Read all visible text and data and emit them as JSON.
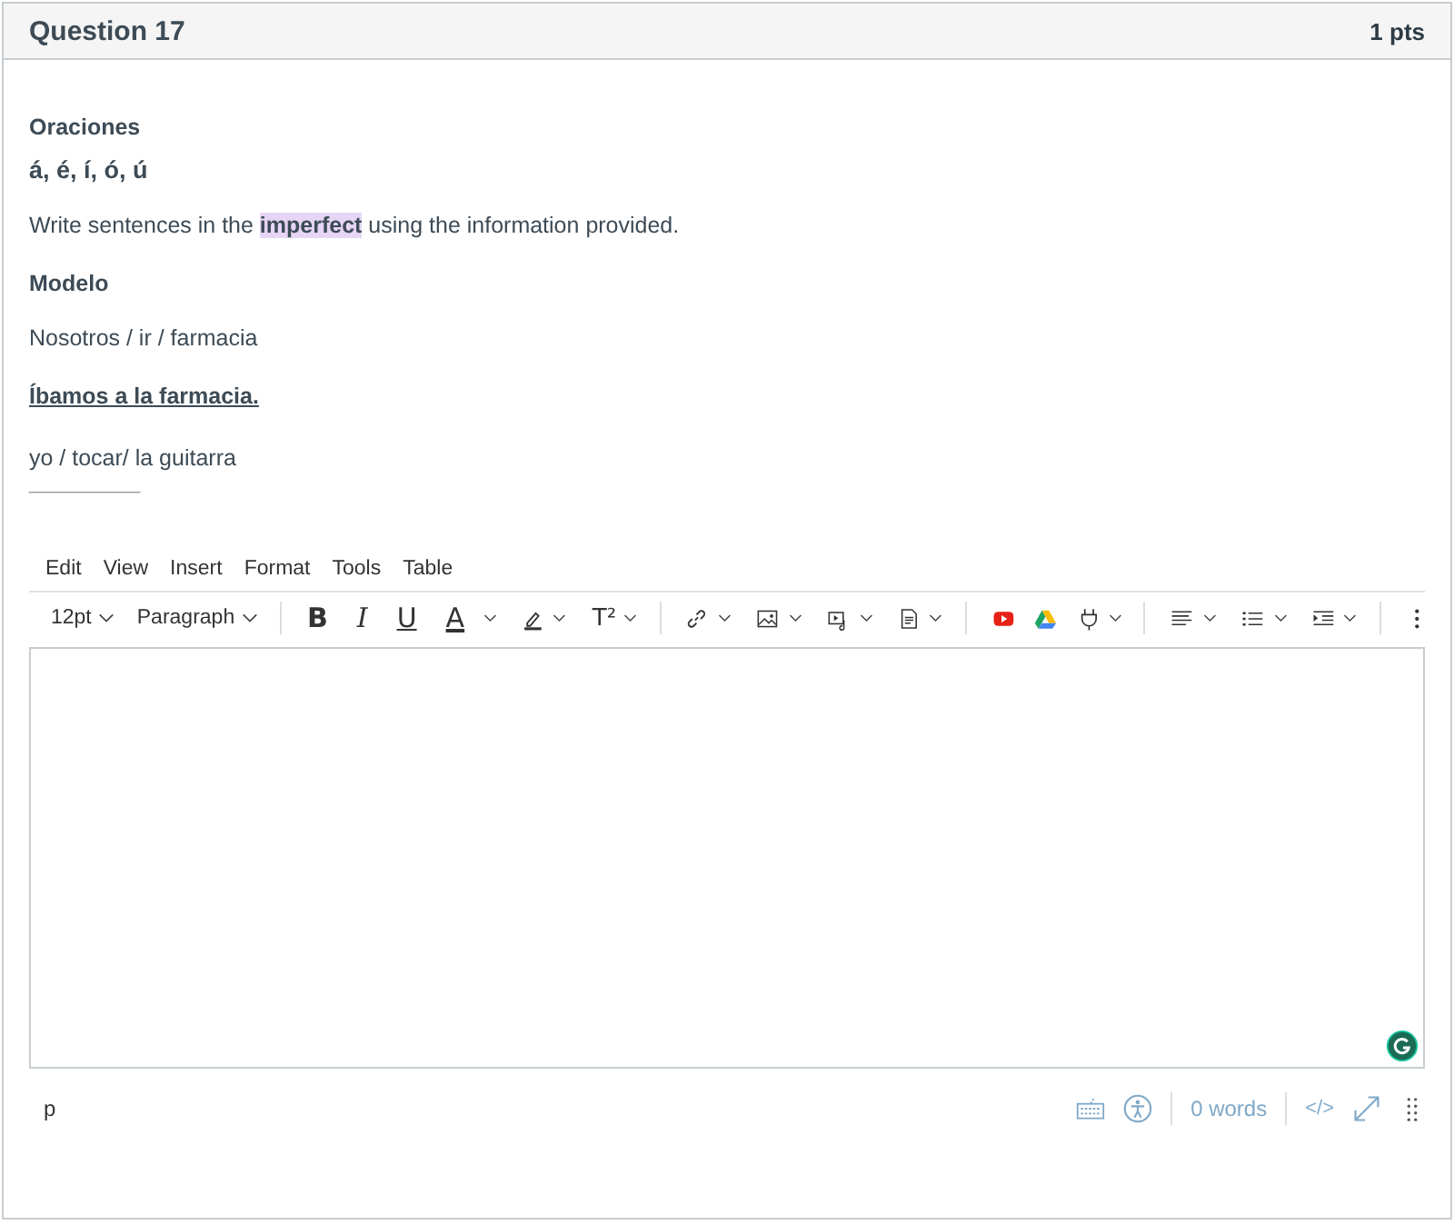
{
  "header": {
    "title": "Question 17",
    "points": "1 pts"
  },
  "question": {
    "heading": "Oraciones",
    "accents": "á, é, í, ó, ú",
    "instruction": {
      "before": "Write sentences in the ",
      "highlight": "imperfect",
      "after": " using the information provided."
    },
    "model_label": "Modelo",
    "model_prompt": "Nosotros / ir / farmacia",
    "model_answer": "Íbamos a la farmacia.",
    "prompt": "yo / tocar/ la guitarra",
    "blank": "__________"
  },
  "editor": {
    "menus": [
      "Edit",
      "View",
      "Insert",
      "Format",
      "Tools",
      "Table"
    ],
    "toolbar": {
      "font_size": "12pt",
      "block_format": "Paragraph",
      "bold": "B",
      "italic": "I",
      "underline": "U",
      "text_color": "A",
      "superscript": "T²"
    },
    "status": {
      "path": "p",
      "word_count": "0 words",
      "code_view": "</>"
    }
  }
}
